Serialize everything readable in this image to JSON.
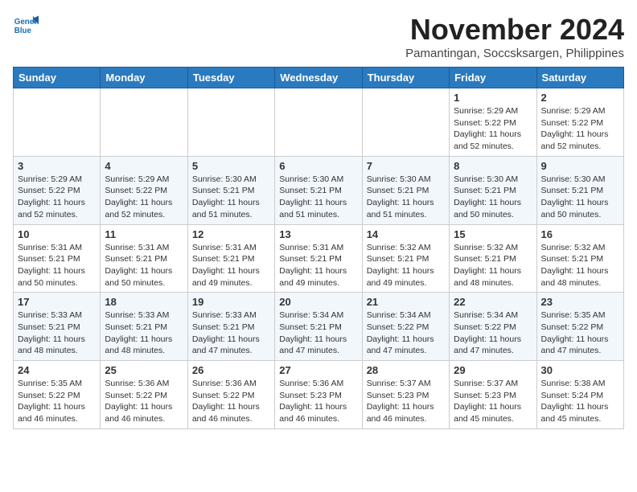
{
  "header": {
    "logo_line1": "General",
    "logo_line2": "Blue",
    "month": "November 2024",
    "location": "Pamantingan, Soccsksargen, Philippines"
  },
  "weekdays": [
    "Sunday",
    "Monday",
    "Tuesday",
    "Wednesday",
    "Thursday",
    "Friday",
    "Saturday"
  ],
  "weeks": [
    [
      {
        "day": "",
        "info": ""
      },
      {
        "day": "",
        "info": ""
      },
      {
        "day": "",
        "info": ""
      },
      {
        "day": "",
        "info": ""
      },
      {
        "day": "",
        "info": ""
      },
      {
        "day": "1",
        "info": "Sunrise: 5:29 AM\nSunset: 5:22 PM\nDaylight: 11 hours\nand 52 minutes."
      },
      {
        "day": "2",
        "info": "Sunrise: 5:29 AM\nSunset: 5:22 PM\nDaylight: 11 hours\nand 52 minutes."
      }
    ],
    [
      {
        "day": "3",
        "info": "Sunrise: 5:29 AM\nSunset: 5:22 PM\nDaylight: 11 hours\nand 52 minutes."
      },
      {
        "day": "4",
        "info": "Sunrise: 5:29 AM\nSunset: 5:22 PM\nDaylight: 11 hours\nand 52 minutes."
      },
      {
        "day": "5",
        "info": "Sunrise: 5:30 AM\nSunset: 5:21 PM\nDaylight: 11 hours\nand 51 minutes."
      },
      {
        "day": "6",
        "info": "Sunrise: 5:30 AM\nSunset: 5:21 PM\nDaylight: 11 hours\nand 51 minutes."
      },
      {
        "day": "7",
        "info": "Sunrise: 5:30 AM\nSunset: 5:21 PM\nDaylight: 11 hours\nand 51 minutes."
      },
      {
        "day": "8",
        "info": "Sunrise: 5:30 AM\nSunset: 5:21 PM\nDaylight: 11 hours\nand 50 minutes."
      },
      {
        "day": "9",
        "info": "Sunrise: 5:30 AM\nSunset: 5:21 PM\nDaylight: 11 hours\nand 50 minutes."
      }
    ],
    [
      {
        "day": "10",
        "info": "Sunrise: 5:31 AM\nSunset: 5:21 PM\nDaylight: 11 hours\nand 50 minutes."
      },
      {
        "day": "11",
        "info": "Sunrise: 5:31 AM\nSunset: 5:21 PM\nDaylight: 11 hours\nand 50 minutes."
      },
      {
        "day": "12",
        "info": "Sunrise: 5:31 AM\nSunset: 5:21 PM\nDaylight: 11 hours\nand 49 minutes."
      },
      {
        "day": "13",
        "info": "Sunrise: 5:31 AM\nSunset: 5:21 PM\nDaylight: 11 hours\nand 49 minutes."
      },
      {
        "day": "14",
        "info": "Sunrise: 5:32 AM\nSunset: 5:21 PM\nDaylight: 11 hours\nand 49 minutes."
      },
      {
        "day": "15",
        "info": "Sunrise: 5:32 AM\nSunset: 5:21 PM\nDaylight: 11 hours\nand 48 minutes."
      },
      {
        "day": "16",
        "info": "Sunrise: 5:32 AM\nSunset: 5:21 PM\nDaylight: 11 hours\nand 48 minutes."
      }
    ],
    [
      {
        "day": "17",
        "info": "Sunrise: 5:33 AM\nSunset: 5:21 PM\nDaylight: 11 hours\nand 48 minutes."
      },
      {
        "day": "18",
        "info": "Sunrise: 5:33 AM\nSunset: 5:21 PM\nDaylight: 11 hours\nand 48 minutes."
      },
      {
        "day": "19",
        "info": "Sunrise: 5:33 AM\nSunset: 5:21 PM\nDaylight: 11 hours\nand 47 minutes."
      },
      {
        "day": "20",
        "info": "Sunrise: 5:34 AM\nSunset: 5:21 PM\nDaylight: 11 hours\nand 47 minutes."
      },
      {
        "day": "21",
        "info": "Sunrise: 5:34 AM\nSunset: 5:22 PM\nDaylight: 11 hours\nand 47 minutes."
      },
      {
        "day": "22",
        "info": "Sunrise: 5:34 AM\nSunset: 5:22 PM\nDaylight: 11 hours\nand 47 minutes."
      },
      {
        "day": "23",
        "info": "Sunrise: 5:35 AM\nSunset: 5:22 PM\nDaylight: 11 hours\nand 47 minutes."
      }
    ],
    [
      {
        "day": "24",
        "info": "Sunrise: 5:35 AM\nSunset: 5:22 PM\nDaylight: 11 hours\nand 46 minutes."
      },
      {
        "day": "25",
        "info": "Sunrise: 5:36 AM\nSunset: 5:22 PM\nDaylight: 11 hours\nand 46 minutes."
      },
      {
        "day": "26",
        "info": "Sunrise: 5:36 AM\nSunset: 5:22 PM\nDaylight: 11 hours\nand 46 minutes."
      },
      {
        "day": "27",
        "info": "Sunrise: 5:36 AM\nSunset: 5:23 PM\nDaylight: 11 hours\nand 46 minutes."
      },
      {
        "day": "28",
        "info": "Sunrise: 5:37 AM\nSunset: 5:23 PM\nDaylight: 11 hours\nand 46 minutes."
      },
      {
        "day": "29",
        "info": "Sunrise: 5:37 AM\nSunset: 5:23 PM\nDaylight: 11 hours\nand 45 minutes."
      },
      {
        "day": "30",
        "info": "Sunrise: 5:38 AM\nSunset: 5:24 PM\nDaylight: 11 hours\nand 45 minutes."
      }
    ]
  ]
}
